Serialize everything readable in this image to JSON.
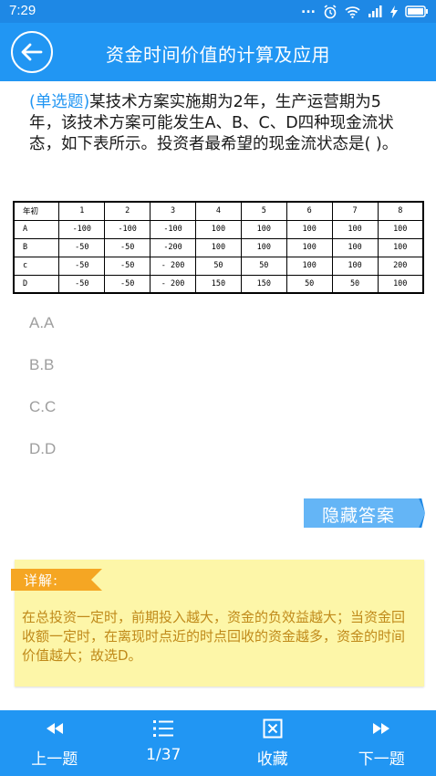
{
  "status_bar": {
    "time": "7:29",
    "dots": "..."
  },
  "header": {
    "title": "资金时间价值的计算及应用",
    "back_icon": "arrow-left-icon"
  },
  "question": {
    "type_label": "(单选题)",
    "text": "某技术方案实施期为2年，生产运营期为5年，该技术方案可能发生A、B、C、D四种现金流状态，如下表所示。投资者最希望的现金流状态是(   )。"
  },
  "table": {
    "header": [
      "年初",
      "1",
      "2",
      "3",
      "4",
      "5",
      "6",
      "7",
      "8"
    ],
    "rows": [
      [
        "A",
        "-100",
        "-100",
        "-100",
        "100",
        "100",
        "100",
        "100",
        "100"
      ],
      [
        "B",
        "-50",
        "-50",
        "-200",
        "100",
        "100",
        "100",
        "100",
        "100"
      ],
      [
        "c",
        "-50",
        "-50",
        "- 200",
        "50",
        "50",
        "100",
        "100",
        "200"
      ],
      [
        "D",
        "-50",
        "-50",
        "- 200",
        "150",
        "150",
        "50",
        "50",
        "100"
      ]
    ]
  },
  "options": [
    "A.A",
    "B.B",
    "C.C",
    "D.D"
  ],
  "hide_answer_label": "隐藏答案",
  "explanation": {
    "tag": "详解:",
    "text": "在总投资一定时，前期投入越大，资金的负效益越大；当资金回收额一定时，在离现时点近的时点回收的资金越多，资金的时间价值越大；故选D。"
  },
  "bottom_nav": {
    "prev": {
      "label": "上一题",
      "icon": "rewind-icon"
    },
    "list": {
      "label": "1/37",
      "icon": "list-icon"
    },
    "favorite": {
      "label": "收藏",
      "icon": "checkbox-x-icon"
    },
    "next": {
      "label": "下一题",
      "icon": "fast-forward-icon"
    }
  },
  "colors": {
    "primary": "#2196f3",
    "status_bar": "#1e88e5",
    "explanation_bg": "#fdf6a8",
    "explanation_text": "#c08a1a",
    "tag": "#f5a623",
    "option_text": "#9e9e9e"
  }
}
